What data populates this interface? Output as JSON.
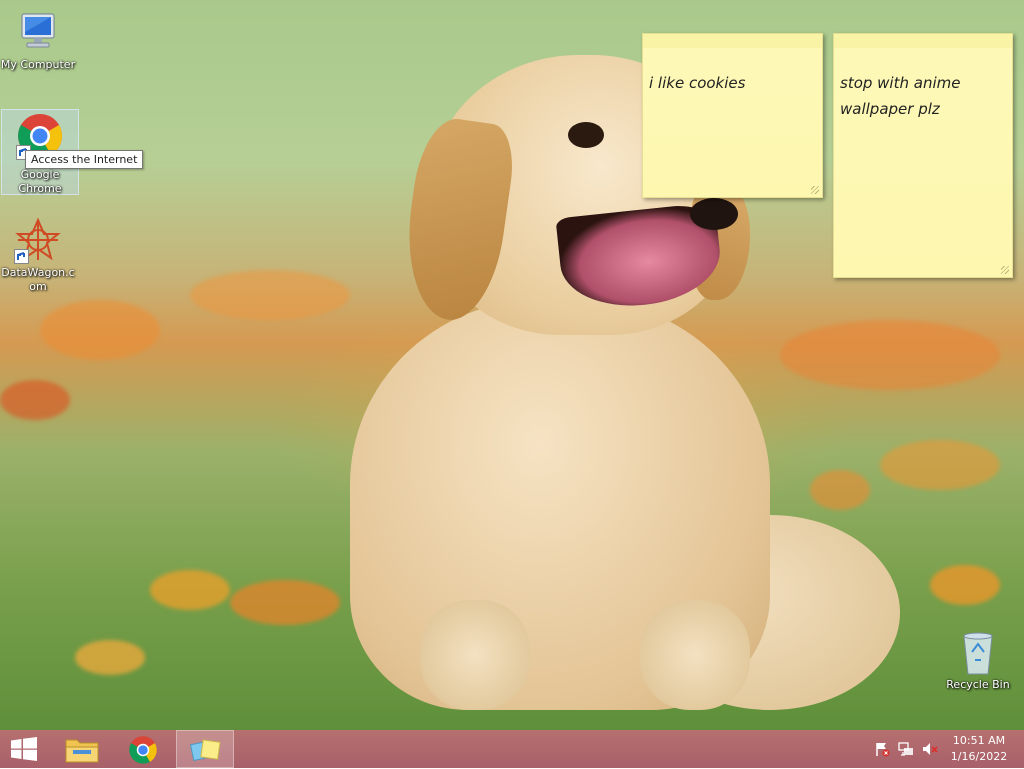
{
  "desktop": {
    "icons": [
      {
        "label": "My Computer",
        "icon": "computer-icon"
      },
      {
        "label": "Google Chrome",
        "icon": "chrome-icon"
      },
      {
        "label": "DataWagon.com",
        "icon": "datawagon-icon"
      }
    ],
    "tooltip": "Access the Internet",
    "recycle_bin": {
      "label": "Recycle Bin",
      "icon": "recycle-bin-icon"
    }
  },
  "sticky_notes": [
    {
      "text": "i like cookies"
    },
    {
      "text": "stop with anime wallpaper plz"
    }
  ],
  "taskbar": {
    "buttons": [
      {
        "name": "start",
        "icon": "windows-logo-icon"
      },
      {
        "name": "file-explorer",
        "icon": "folder-icon"
      },
      {
        "name": "chrome",
        "icon": "chrome-icon"
      },
      {
        "name": "sticky-notes",
        "icon": "sticky-notes-icon",
        "active": true
      }
    ],
    "tray": {
      "icons": [
        "action-center-flag-icon",
        "network-icon",
        "volume-muted-icon"
      ],
      "time": "10:51 AM",
      "date": "1/16/2022"
    }
  },
  "colors": {
    "taskbar": "#b0676c",
    "sticky": "#fdf8b7"
  }
}
